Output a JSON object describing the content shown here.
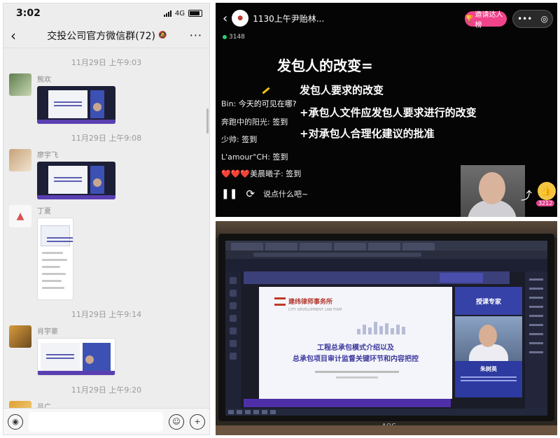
{
  "chat": {
    "status": {
      "time": "3:02",
      "network": "4G"
    },
    "header": {
      "back": "‹",
      "title": "交投公司官方微信群(72)",
      "more": "···"
    },
    "messages": [
      {
        "time": "11月29日 上午9:03",
        "sender": "熊欢"
      },
      {
        "time": "11月29日 上午9:08",
        "sender": "廖宇飞"
      },
      {
        "time": "",
        "sender": "丁夏"
      },
      {
        "time": "11月29日 上午9:14",
        "sender": "肖宇豪"
      },
      {
        "time": "11月29日 上午9:20",
        "sender": "吕广"
      }
    ]
  },
  "live": {
    "title": "1130上午尹贻林...",
    "viewers": "3148",
    "invite_label": "邀请达人榜",
    "heading": "发包人的改变=",
    "lines": [
      "发包人要求的改变",
      "+承包人文件应发包人要求进行的改变",
      "+对承包人合理化建议的批准"
    ],
    "comments": [
      {
        "name": "Bin:",
        "text": "今天的可见在哪?"
      },
      {
        "name": "奔跑中的阳光:",
        "text": "签到"
      },
      {
        "name": "少帅:",
        "text": "签到"
      },
      {
        "name": "L'amour°CH:",
        "text": "签到"
      },
      {
        "name": "❤️❤️❤️美晨曦子:",
        "text": "签到"
      }
    ],
    "say_placeholder": "说点什么吧~",
    "like_count": "3212"
  },
  "screen": {
    "firm_name": "建纬律师事务所",
    "firm_en": "CITY DEVELOPMENT LAW FIRM",
    "ppt_title_1": "工程总承包模式介绍以及",
    "ppt_title_2": "总承包项目审计监督关键环节和内容把控",
    "expert_label": "授课专家",
    "expert_name": "朱树英",
    "monitor_brand": "AOC"
  },
  "colors": {
    "wechat_bg": "#ededed",
    "invite_pink": "#f0438a",
    "slide_purple": "#3d3a9e",
    "firm_red": "#b03a2e"
  }
}
